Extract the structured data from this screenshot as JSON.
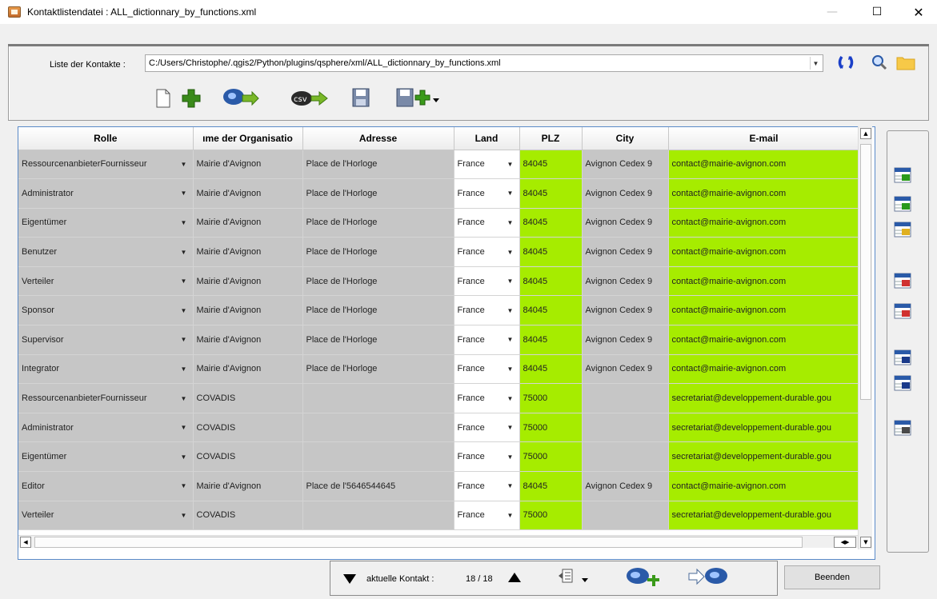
{
  "window": {
    "title": "Kontaktlistendatei : ALL_dictionnary_by_functions.xml",
    "minimize_glyph": "—",
    "maximize_glyph": "☐",
    "close_glyph": "✕"
  },
  "file_selector": {
    "label": "Liste der Kontakte :",
    "path": "C:/Users/Christophe/.qgis2/Python/plugins/qsphere/xml/ALL_dictionnary_by_functions.xml"
  },
  "toolbar_icons": [
    "new-file-icon",
    "add-contact-icon",
    "add-contacts-icon",
    "import-csv-icon",
    "save-icon",
    "save-as-icon"
  ],
  "toolbar": {
    "csv_label": "csv"
  },
  "grid": {
    "columns": [
      "Rolle",
      "ıme der Organisatio",
      "Adresse",
      "Land",
      "PLZ",
      "City",
      "E-mail"
    ],
    "rows": [
      {
        "role": "RessourcenanbieterFournisseur",
        "org": "Mairie d'Avignon",
        "address": " Place de l'Horloge",
        "country": "France",
        "plz": "84045",
        "city": "Avignon Cedex 9",
        "email": "contact@mairie-avignon.com"
      },
      {
        "role": "Administrator",
        "org": "Mairie d'Avignon",
        "address": "Place de l'Horloge",
        "country": "France",
        "plz": "84045",
        "city": "Avignon Cedex 9",
        "email": "contact@mairie-avignon.com"
      },
      {
        "role": "Eigentümer",
        "org": "Mairie d'Avignon",
        "address": "Place de l'Horloge",
        "country": "France",
        "plz": "84045",
        "city": "Avignon Cedex 9",
        "email": "contact@mairie-avignon.com"
      },
      {
        "role": "Benutzer",
        "org": "Mairie d'Avignon",
        "address": "  Place de l'Horloge",
        "country": "France",
        "plz": "84045",
        "city": "Avignon Cedex 9",
        "email": "contact@mairie-avignon.com"
      },
      {
        "role": "Verteiler",
        "org": "Mairie d'Avignon",
        "address": "  Place de l'Horloge",
        "country": "France",
        "plz": "84045",
        "city": "Avignon Cedex 9",
        "email": "contact@mairie-avignon.com"
      },
      {
        "role": "Sponsor",
        "org": "Mairie d'Avignon",
        "address": "Place de l'Horloge",
        "country": "France",
        "plz": "84045",
        "city": "Avignon Cedex 9",
        "email": "contact@mairie-avignon.com"
      },
      {
        "role": "Supervisor",
        "org": "Mairie d'Avignon",
        "address": "  Place de l'Horloge",
        "country": "France",
        "plz": "84045",
        "city": "Avignon Cedex 9",
        "email": "contact@mairie-avignon.com"
      },
      {
        "role": "Integrator",
        "org": "Mairie d'Avignon",
        "address": "  Place de l'Horloge",
        "country": "France",
        "plz": "84045",
        "city": "Avignon Cedex 9",
        "email": "contact@mairie-avignon.com"
      },
      {
        "role": "RessourcenanbieterFournisseur",
        "org": "COVADIS",
        "address": "",
        "country": "France",
        "plz": "75000",
        "city": "",
        "email": "secretariat@developpement-durable.gou"
      },
      {
        "role": "Administrator",
        "org": "COVADIS",
        "address": "",
        "country": "France",
        "plz": "75000",
        "city": "",
        "email": "secretariat@developpement-durable.gou"
      },
      {
        "role": "Eigentümer",
        "org": "COVADIS",
        "address": "",
        "country": "France",
        "plz": "75000",
        "city": "",
        "email": "secretariat@developpement-durable.gou"
      },
      {
        "role": "Editor",
        "org": "Mairie d'Avignon",
        "address": "Place de l'5646544645",
        "country": "France",
        "plz": "84045",
        "city": "Avignon Cedex 9",
        "email": "contact@mairie-avignon.com"
      },
      {
        "role": "Verteiler",
        "org": "COVADIS",
        "address": "",
        "country": "France",
        "plz": "75000",
        "city": "",
        "email": "secretariat@developpement-durable.gou"
      }
    ]
  },
  "side_toolbar_icons": [
    "insert-row-icon",
    "insert-row-below-icon",
    "insert-row-above-icon",
    "delete-row-icon",
    "delete-column-icon",
    "move-row-up-icon",
    "move-row-down-icon",
    "table-icon"
  ],
  "navigation": {
    "label": "aktuelle Kontakt :",
    "position": "18 / 18",
    "quit_label": "Beenden"
  }
}
